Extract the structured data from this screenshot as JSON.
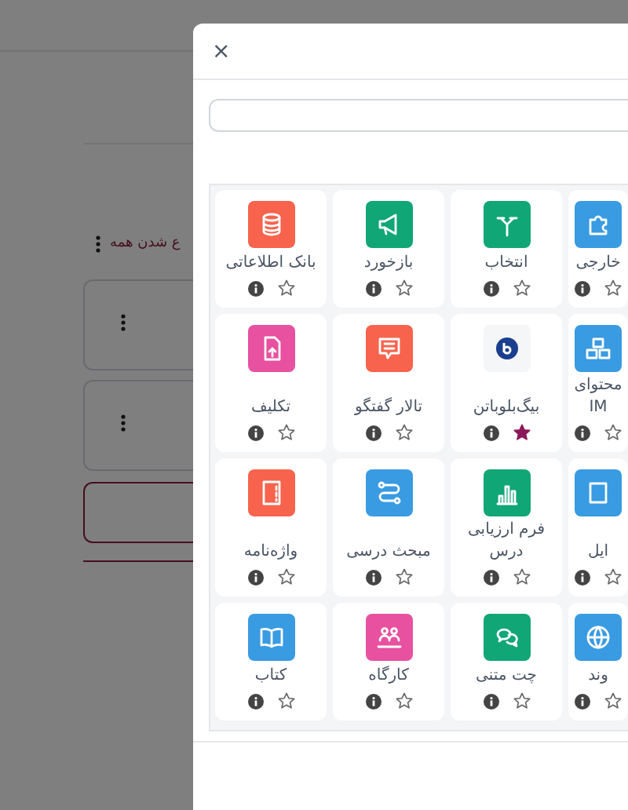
{
  "page": {
    "collapse_all_link": "ع شدن همه",
    "sections": [
      {
        "kind": "section"
      },
      {
        "kind": "section"
      },
      {
        "kind": "add"
      }
    ]
  },
  "modal": {
    "close": "×",
    "activities": [
      {
        "label": "خارجی",
        "color": "#399be2",
        "kind": "puzzle",
        "starred": false
      },
      {
        "label": "انتخاب",
        "color": "#11a676",
        "kind": "fork",
        "starred": false
      },
      {
        "label": "بازخورد",
        "color": "#11a676",
        "kind": "megaphone",
        "starred": false
      },
      {
        "label": "بانک اطلاعاتی",
        "color": "#f7634d",
        "kind": "database",
        "starred": false
      },
      {
        "label": "محتوای IM",
        "color": "#399be2",
        "kind": "boxes",
        "starred": false
      },
      {
        "label": "بیگ‌بلوباتن",
        "color": "#f5f6f8",
        "kind": "bbb",
        "starred": true
      },
      {
        "label": "تالار گفتگو",
        "color": "#f7634d",
        "kind": "chat",
        "starred": false
      },
      {
        "label": "تکلیف",
        "color": "#e7519f",
        "kind": "upload",
        "starred": false
      },
      {
        "label": "ایل",
        "color": "#399be2",
        "kind": "file",
        "starred": false
      },
      {
        "label": "فرم ارزیابی درس",
        "color": "#11a676",
        "kind": "chart",
        "starred": false
      },
      {
        "label": "مبحث درسی",
        "color": "#399be2",
        "kind": "path",
        "starred": false
      },
      {
        "label": "واژه‌نامه",
        "color": "#f7634d",
        "kind": "notebook",
        "starred": false
      },
      {
        "label": "وند",
        "color": "#399be2",
        "kind": "globe",
        "starred": false
      },
      {
        "label": "چت متنی",
        "color": "#11a676",
        "kind": "bubbles",
        "starred": false
      },
      {
        "label": "کارگاه",
        "color": "#e7519f",
        "kind": "people",
        "starred": false
      },
      {
        "label": "کتاب",
        "color": "#399be2",
        "kind": "book",
        "starred": false
      }
    ]
  }
}
